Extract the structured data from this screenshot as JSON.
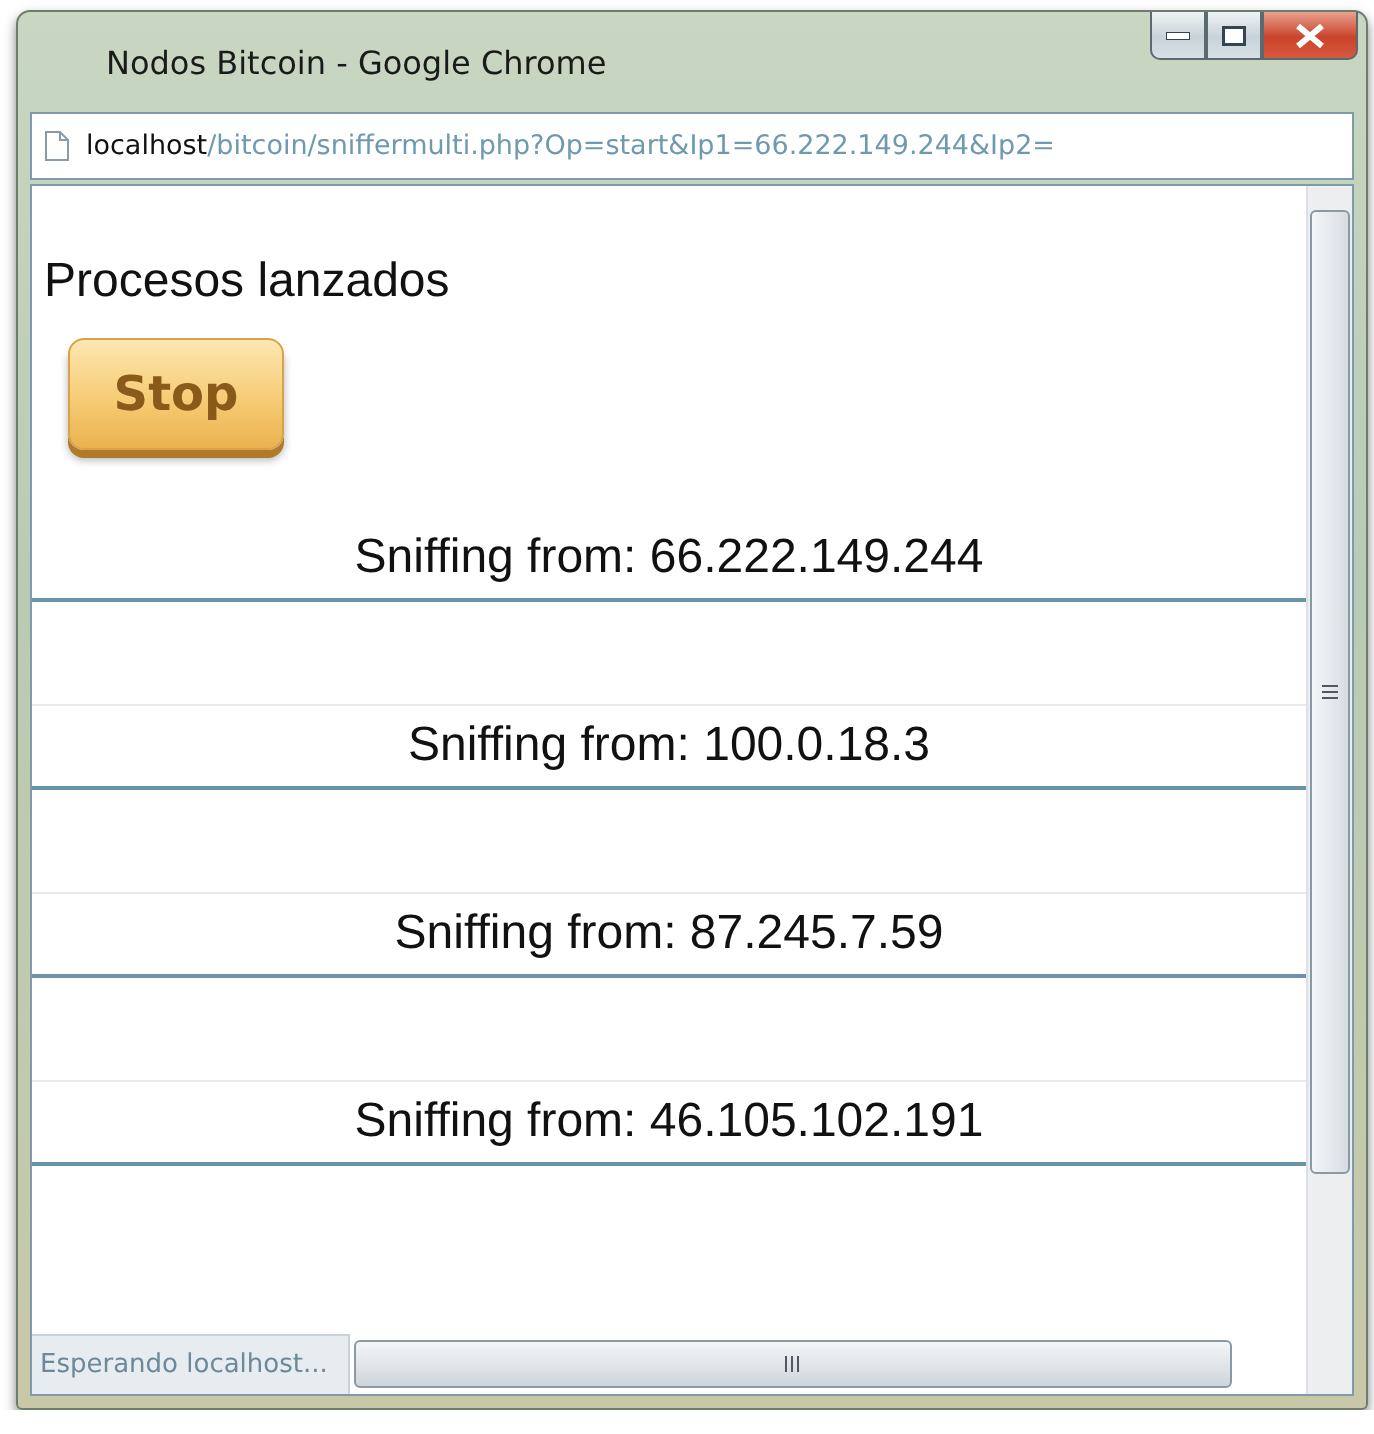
{
  "window": {
    "title": "Nodos Bitcoin - Google Chrome"
  },
  "address_bar": {
    "host": "localhost",
    "path": "/bitcoin/sniffermulti.php?Op=start&Ip1=66.222.149.244&Ip2="
  },
  "page": {
    "heading": "Procesos lanzados",
    "stop_button": "Stop",
    "sniffers": [
      {
        "label": "Sniffing from: 66.222.149.244"
      },
      {
        "label": "Sniffing from: 100.0.18.3"
      },
      {
        "label": "Sniffing from: 87.245.7.59"
      },
      {
        "label": "Sniffing from: 46.105.102.191"
      }
    ]
  },
  "status_bar": {
    "text": "Esperando localhost..."
  }
}
